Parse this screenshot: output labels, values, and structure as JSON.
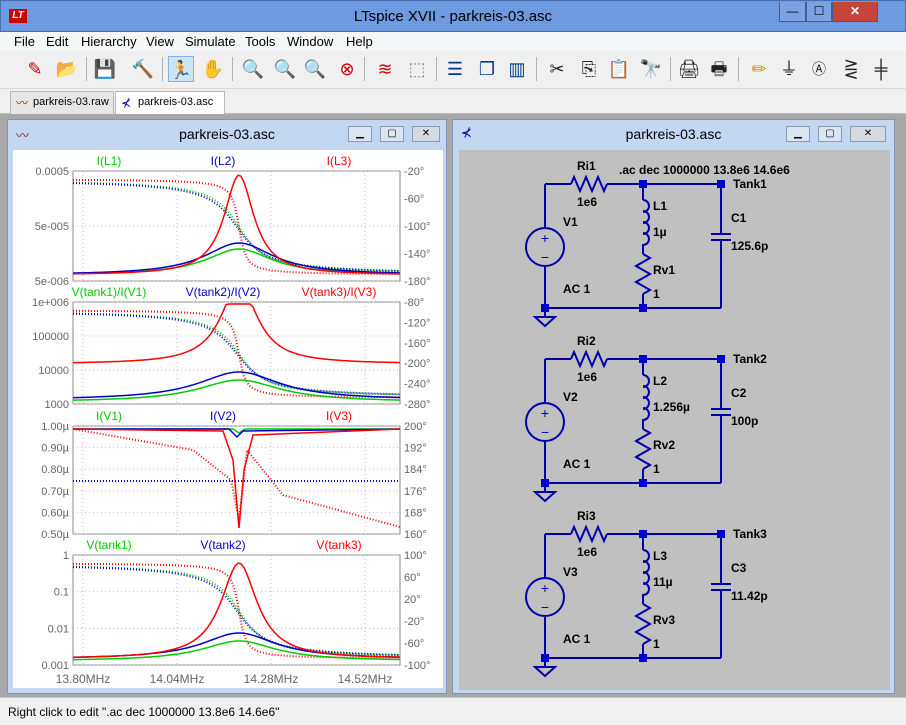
{
  "app": {
    "logo": "LT",
    "title": "LTspice XVII - parkreis-03.asc",
    "controls": {
      "minimize": "—",
      "maximize": "☐",
      "close": "✕"
    }
  },
  "menu": [
    "File",
    "Edit",
    "Hierarchy",
    "View",
    "Simulate",
    "Tools",
    "Window",
    "Help"
  ],
  "toolbar_icons": [
    "new-schematic",
    "open",
    "save",
    "control-panel",
    "run",
    "halt",
    "zoom-in",
    "pan",
    "zoom-out",
    "zoom-cancel",
    "autorange",
    "fit",
    "tile-horizontal",
    "cascade",
    "tile-vertical",
    "cut",
    "copy",
    "paste",
    "find",
    "print-setup",
    "print",
    "draw-wire",
    "ground",
    "label-net",
    "resistor",
    "capacitor"
  ],
  "tabs": [
    {
      "label": "parkreis-03.raw",
      "icon": "waveform-icon",
      "active": false
    },
    {
      "label": "parkreis-03.asc",
      "icon": "schematic-icon",
      "active": true
    }
  ],
  "colors": {
    "green": "#00cc00",
    "blue": "#0000cc",
    "red": "#ff0000",
    "wire": "#0000aa",
    "node": "#0000cc"
  },
  "plot_window": {
    "title": "parkreis-03.asc",
    "panes": [
      {
        "traces": [
          "I(L1)",
          "I(L2)",
          "I(L3)"
        ],
        "left_ticks": [
          "0.0005",
          "5e-005",
          "5e-006"
        ],
        "right_ticks": [
          "-20°",
          "-60°",
          "-100°",
          "-140°",
          "-180°"
        ]
      },
      {
        "traces": [
          "V(tank1)/I(V1)",
          "V(tank2)/I(V2)",
          "V(tank3)/I(V3)"
        ],
        "left_ticks": [
          "1e+006",
          "100000",
          "10000",
          "1000"
        ],
        "right_ticks": [
          "-80°",
          "-120°",
          "-160°",
          "-200°",
          "-240°",
          "-280°"
        ]
      },
      {
        "traces": [
          "I(V1)",
          "I(V2)",
          "I(V3)"
        ],
        "left_ticks": [
          "1.00µ",
          "0.90µ",
          "0.80µ",
          "0.70µ",
          "0.60µ",
          "0.50µ"
        ],
        "right_ticks": [
          "200°",
          "192°",
          "184°",
          "176°",
          "168°",
          "160°"
        ]
      },
      {
        "traces": [
          "V(tank1)",
          "V(tank2)",
          "V(tank3)"
        ],
        "left_ticks": [
          "1",
          "0.1",
          "0.01",
          "0.001"
        ],
        "right_ticks": [
          "100°",
          "60°",
          "20°",
          "-20°",
          "-60°",
          "-100°"
        ]
      }
    ],
    "x_ticks": [
      "13.80MHz",
      "14.04MHz",
      "14.28MHz",
      "14.52MHz"
    ]
  },
  "schematic_window": {
    "title": "parkreis-03.asc",
    "directive": ".ac dec 1000000 13.8e6 14.6e6",
    "tanks": [
      {
        "ri": "Ri1",
        "ri_val": "1e6",
        "v": "V1",
        "v_val": "AC 1",
        "l": "L1",
        "l_val": "1µ",
        "rv": "Rv1",
        "rv_val": "1",
        "c": "C1",
        "c_val": "125.6p",
        "net": "Tank1"
      },
      {
        "ri": "Ri2",
        "ri_val": "1e6",
        "v": "V2",
        "v_val": "AC 1",
        "l": "L2",
        "l_val": "1.256µ",
        "rv": "Rv2",
        "rv_val": "1",
        "c": "C2",
        "c_val": "100p",
        "net": "Tank2"
      },
      {
        "ri": "Ri3",
        "ri_val": "1e6",
        "v": "V3",
        "v_val": "AC 1",
        "l": "L3",
        "l_val": "11µ",
        "rv": "Rv3",
        "rv_val": "1",
        "c": "C3",
        "c_val": "11.42p",
        "net": "Tank3"
      }
    ]
  },
  "status": "Right click to edit \".ac dec 1000000 13.8e6 14.6e6\""
}
